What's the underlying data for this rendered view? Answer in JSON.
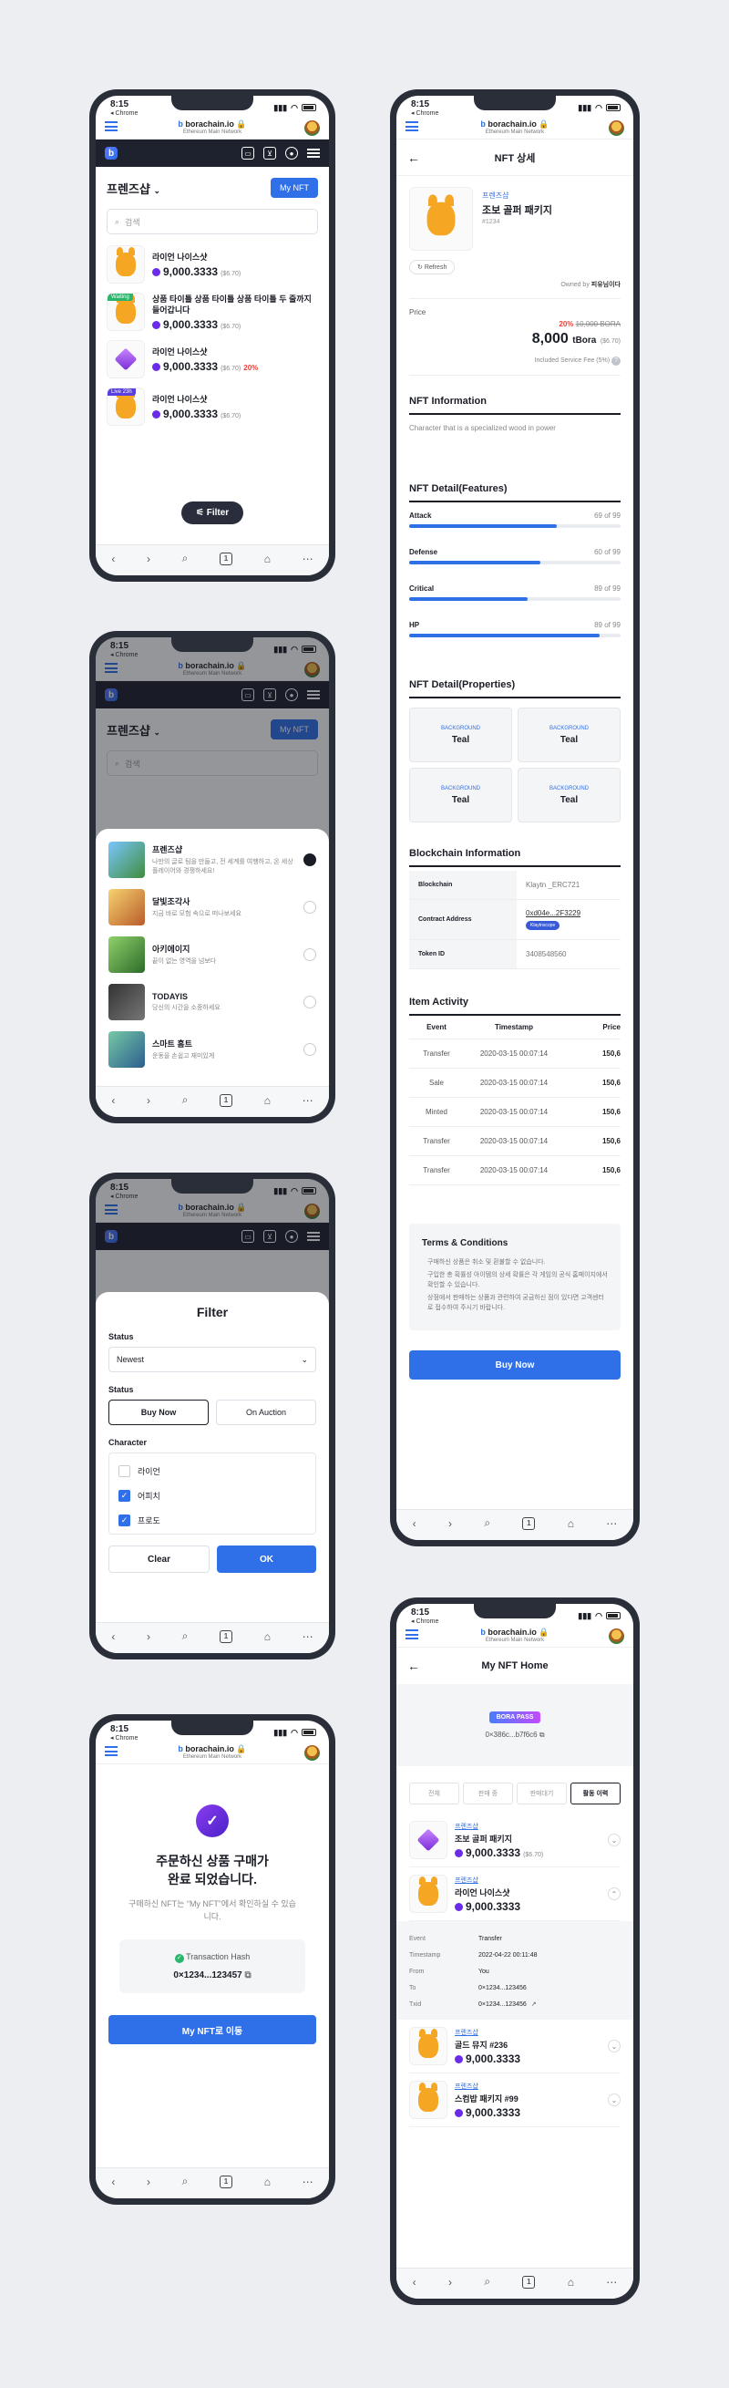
{
  "browser": {
    "time": "8:15",
    "back": "◂ Chrome",
    "host_prefix": "b",
    "host": "borachain.io",
    "network": "Ethereum Main Network",
    "tabs": "1"
  },
  "s1": {
    "collection": "프렌즈샵",
    "my_nft": "My NFT",
    "search_placeholder": "검색",
    "filter": "Filter",
    "items": [
      {
        "name": "라이언 나이스샷",
        "price": "9,000.3333",
        "usd": "($6.70)",
        "tag": "",
        "pct": ""
      },
      {
        "name": "상품 타이틀 상품 타이틀 상품 타이틀 두 줄까지 들어갑니다",
        "price": "9,000.3333",
        "usd": "($6.70)",
        "tag": "Waiting",
        "pct": ""
      },
      {
        "name": "라이언 나이스샷",
        "price": "9,000.3333",
        "usd": "($6.70)",
        "tag": "",
        "pct": "20%"
      },
      {
        "name": "라이언 나이스샷",
        "price": "9,000.3333",
        "usd": "($6.70)",
        "tag": "Live 23h",
        "pct": ""
      }
    ]
  },
  "s2": {
    "collection": "프렌즈샵",
    "my_nft": "My NFT",
    "search_placeholder": "검색",
    "items": [
      {
        "name": "프렌즈샵",
        "desc": "나만의 글로 팀을 만들고, 전 세계를 여행하고, 온 세상 플레이어와 경쟁하세요!"
      },
      {
        "name": "달빛조각사",
        "desc": "지금 바로 모험 속으로 떠나보세요"
      },
      {
        "name": "아키에이지",
        "desc": "끝이 없는 영역을 넘보다"
      },
      {
        "name": "TODAYIS",
        "desc": "당신의 시간을 소중하세요"
      },
      {
        "name": "스마트 홈트",
        "desc": "운동을 손쉽고 재미있게"
      }
    ]
  },
  "s3": {
    "title": "Filter",
    "status_label": "Status",
    "status_value": "Newest",
    "status2_label": "Status",
    "buy_now": "Buy Now",
    "on_auction": "On Auction",
    "character_label": "Character",
    "characters": [
      {
        "name": "라이언",
        "checked": false
      },
      {
        "name": "어피치",
        "checked": true
      },
      {
        "name": "프로도",
        "checked": true
      }
    ],
    "clear": "Clear",
    "ok": "OK"
  },
  "s4": {
    "title_line1": "주문하신 상품 구매가",
    "title_line2": "완료 되었습니다.",
    "desc": "구매하신 NFT는 “My NFT”에서 확인하실 수 있습니다.",
    "tx_label": "Transaction Hash",
    "tx_value": "0×1234...123457",
    "button": "My NFT로 이동"
  },
  "s5": {
    "header": "NFT 상세",
    "collection": "프렌즈샵",
    "name": "조보 골퍼 패키지",
    "id": "#1234",
    "refresh": "Refresh",
    "owned_label": "Owned by",
    "owner": "피유님이다",
    "price_label": "Price",
    "discount": "20%",
    "old_price": "10,000 BORA",
    "price": "8,000",
    "unit": "tBora",
    "usd": "($6.70)",
    "fee": "Included Service Fee (5%)",
    "info_title": "NFT Information",
    "info_text": "Character that is a specialized wood in power",
    "features_title": "NFT Detail(Features)",
    "features": [
      {
        "name": "Attack",
        "value": "69 of 99",
        "ratio": 0.7
      },
      {
        "name": "Defense",
        "value": "60 of 99",
        "ratio": 0.62
      },
      {
        "name": "Critical",
        "value": "89 of 99",
        "ratio": 0.56
      },
      {
        "name": "HP",
        "value": "89 of 99",
        "ratio": 0.9
      }
    ],
    "props_title": "NFT Detail(Properties)",
    "props": [
      {
        "label": "BACKGROUND",
        "value": "Teal"
      },
      {
        "label": "BACKGROUND",
        "value": "Teal"
      },
      {
        "label": "BACKGROUND",
        "value": "Teal"
      },
      {
        "label": "BACKGROUND",
        "value": "Teal"
      }
    ],
    "chain_title": "Blockchain Information",
    "chain": [
      {
        "k": "Blockchain",
        "v": "Klaytn _ERC721"
      },
      {
        "k": "Contract Address",
        "v": "0xd04e...2F3229",
        "badge": "Klaytnscope"
      },
      {
        "k": "Token ID",
        "v": "3408548560"
      }
    ],
    "activity_title": "Item Activity",
    "activity_head": {
      "event": "Event",
      "ts": "Timestamp",
      "price": "Price"
    },
    "activity": [
      {
        "event": "Transfer",
        "ts": "2020-03-15 00:07:14",
        "price": "150,6"
      },
      {
        "event": "Sale",
        "ts": "2020-03-15 00:07:14",
        "price": "150,6"
      },
      {
        "event": "Minted",
        "ts": "2020-03-15 00:07:14",
        "price": "150,6"
      },
      {
        "event": "Transfer",
        "ts": "2020-03-15 00:07:14",
        "price": "150,6"
      },
      {
        "event": "Transfer",
        "ts": "2020-03-15 00:07:14",
        "price": "150,6"
      }
    ],
    "terms_title": "Terms & Conditions",
    "terms": [
      "구매하신 상품은 취소 및 환불할 수 없습니다.",
      "구입한 총 획률성 아이템의 상세 확률은 각 게임의 공식 홈페이지에서 확인할 수 있습니다.",
      "상점에서 판매하는 상품과 관련하여 궁금하신 점이 있다면 고객센터로 접수하여 주시기 바랍니다."
    ],
    "buy": "Buy Now"
  },
  "s6": {
    "header": "My NFT Home",
    "pass": "BORA PASS",
    "address": "0×386c...b7f6c6",
    "tabs": [
      "전체",
      "판매 중",
      "판매대기",
      "활동 이력"
    ],
    "items": [
      {
        "collection": "프렌즈샵",
        "name": "조보 골퍼 패키지",
        "price": "9,000.3333",
        "usd": "($6.70)"
      },
      {
        "collection": "프렌즈샵",
        "name": "라이언 나이스샷",
        "price": "9,000.3333",
        "usd": ""
      },
      {
        "collection": "프렌즈샵",
        "name": "골드 뮤지 #236",
        "price": "9,000.3333",
        "usd": ""
      },
      {
        "collection": "프렌즈샵",
        "name": "스컴밥 패키지 #99",
        "price": "9,000.3333",
        "usd": ""
      }
    ],
    "detail": [
      {
        "k": "Event",
        "v": "Transfer"
      },
      {
        "k": "Timestamp",
        "v": "2022-04-22 00:11:48"
      },
      {
        "k": "From",
        "v": "You"
      },
      {
        "k": "To",
        "v": "0×1234...123456"
      },
      {
        "k": "Txid",
        "v": "0×1234...123456"
      }
    ]
  },
  "colors": {
    "accent": "#2f6fe8",
    "dark": "#1e222e",
    "coin": "#6a2ce8",
    "sale": "#e8433a"
  }
}
